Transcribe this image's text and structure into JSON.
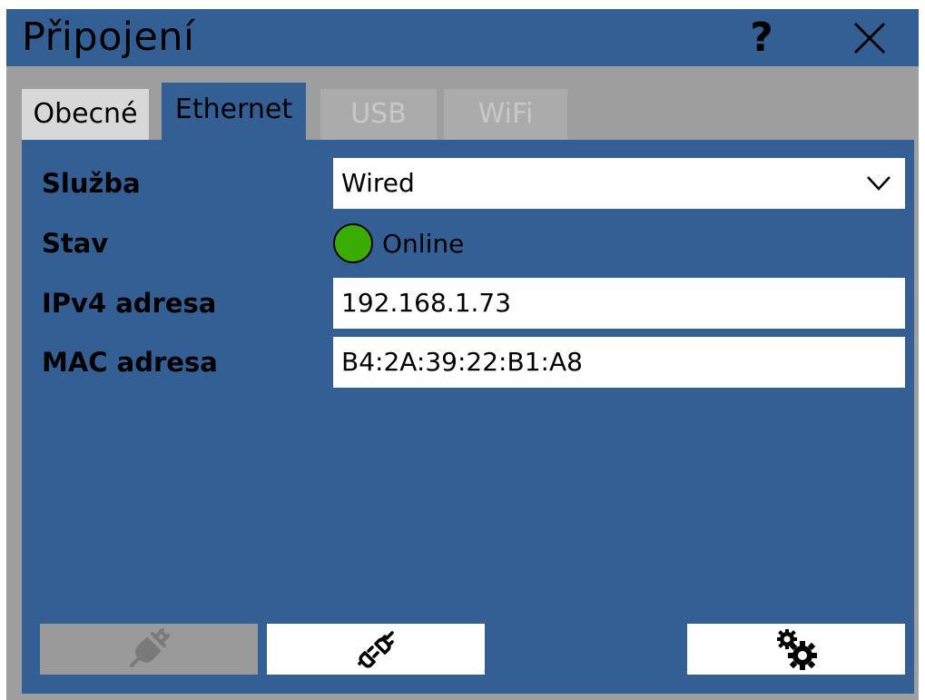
{
  "window": {
    "title": "Připojení",
    "help_label": "?",
    "icons": {
      "help": "help-question-icon",
      "close": "close-x-icon"
    }
  },
  "tabs": [
    {
      "label": "Obecné",
      "state": "normal"
    },
    {
      "label": "Ethernet",
      "state": "active"
    },
    {
      "label": "USB",
      "state": "disabled"
    },
    {
      "label": "WiFi",
      "state": "disabled"
    }
  ],
  "form": {
    "service": {
      "label": "Služba",
      "value": "Wired"
    },
    "status": {
      "label": "Stav",
      "value": "Online",
      "indicator_color": "#3aad05"
    },
    "ipv4": {
      "label": "IPv4 adresa",
      "value": "192.168.1.73"
    },
    "mac": {
      "label": "MAC adresa",
      "value": "B4:2A:39:22:B1:A8"
    }
  },
  "buttons": {
    "disconnect": {
      "icon": "unplugged-plug-icon",
      "enabled": false
    },
    "connect": {
      "icon": "plug-connect-icon",
      "enabled": true
    },
    "settings": {
      "icon": "gears-icon",
      "enabled": true
    }
  },
  "colors": {
    "panel": "#345f95",
    "frame": "#9e9e9e",
    "active_indicator": "#3aad05"
  }
}
